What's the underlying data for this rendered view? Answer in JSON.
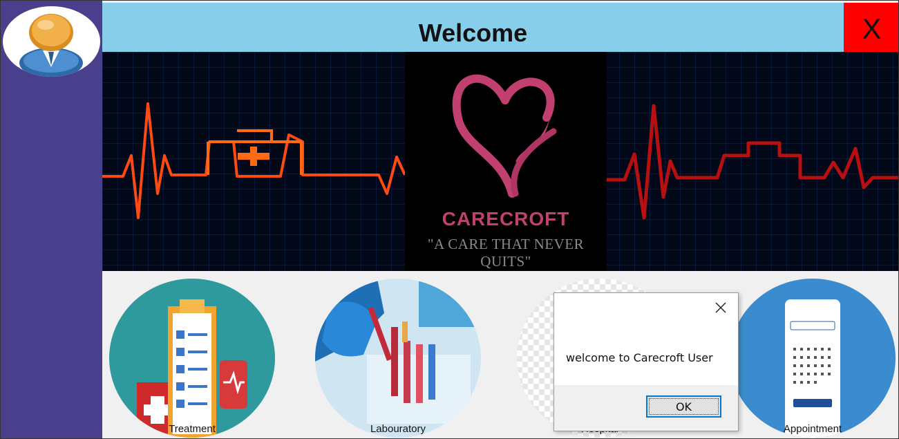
{
  "header": {
    "title": "Welcome",
    "close_label": "X"
  },
  "banner": {
    "brand": "CARECROFT",
    "tagline": "\"A CARE THAT NEVER QUITS\""
  },
  "tiles": [
    {
      "label": "Treatment",
      "icon": "clipboard-icon"
    },
    {
      "label": "Labouratory",
      "icon": "test-tubes-icon"
    },
    {
      "label": "Hospital",
      "icon": "hospital-icon"
    },
    {
      "label": "Appointment",
      "icon": "calendar-phone-icon"
    }
  ],
  "dialog": {
    "message": "welcome to Carecroft User",
    "ok_label": "OK"
  },
  "colors": {
    "sidebar": "#4a3f8c",
    "header": "#87ceeb",
    "close": "#ff0000",
    "brand": "#c2406f"
  }
}
